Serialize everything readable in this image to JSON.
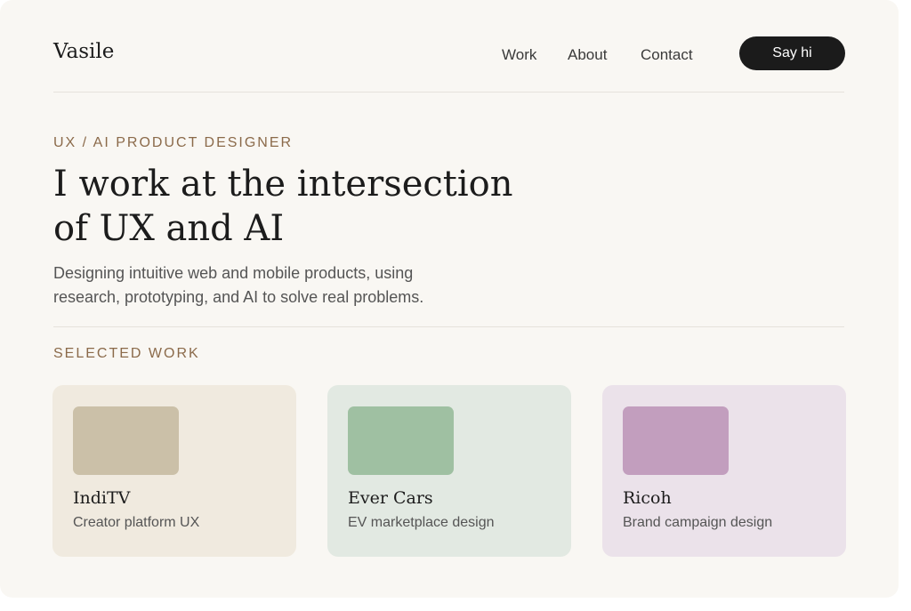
{
  "nav": {
    "logo": "Vasile",
    "links": [
      "Work",
      "About",
      "Contact"
    ],
    "cta": "Say hi"
  },
  "hero": {
    "eyebrow": "UX / AI PRODUCT DESIGNER",
    "headline": "I work at the intersection of UX and AI",
    "subtitle": "Designing intuitive web and mobile products, using research, prototyping, and AI to solve real problems."
  },
  "work": {
    "heading": "SELECTED WORK",
    "projects": [
      {
        "title": "IndiTV",
        "description": "Creator platform UX",
        "card_color": "#f0eadf",
        "thumb_color": "#cbc0a8"
      },
      {
        "title": "Ever Cars",
        "description": "EV marketplace design",
        "card_color": "#e2e9e2",
        "thumb_color": "#9fc0a2"
      },
      {
        "title": "Ricoh",
        "description": "Brand campaign design",
        "card_color": "#ebe2ea",
        "thumb_color": "#c29ebe"
      }
    ]
  },
  "colors": {
    "page_background": "#f9f7f3",
    "accent": "#8b6a4a",
    "button": "#1b1b1b"
  }
}
